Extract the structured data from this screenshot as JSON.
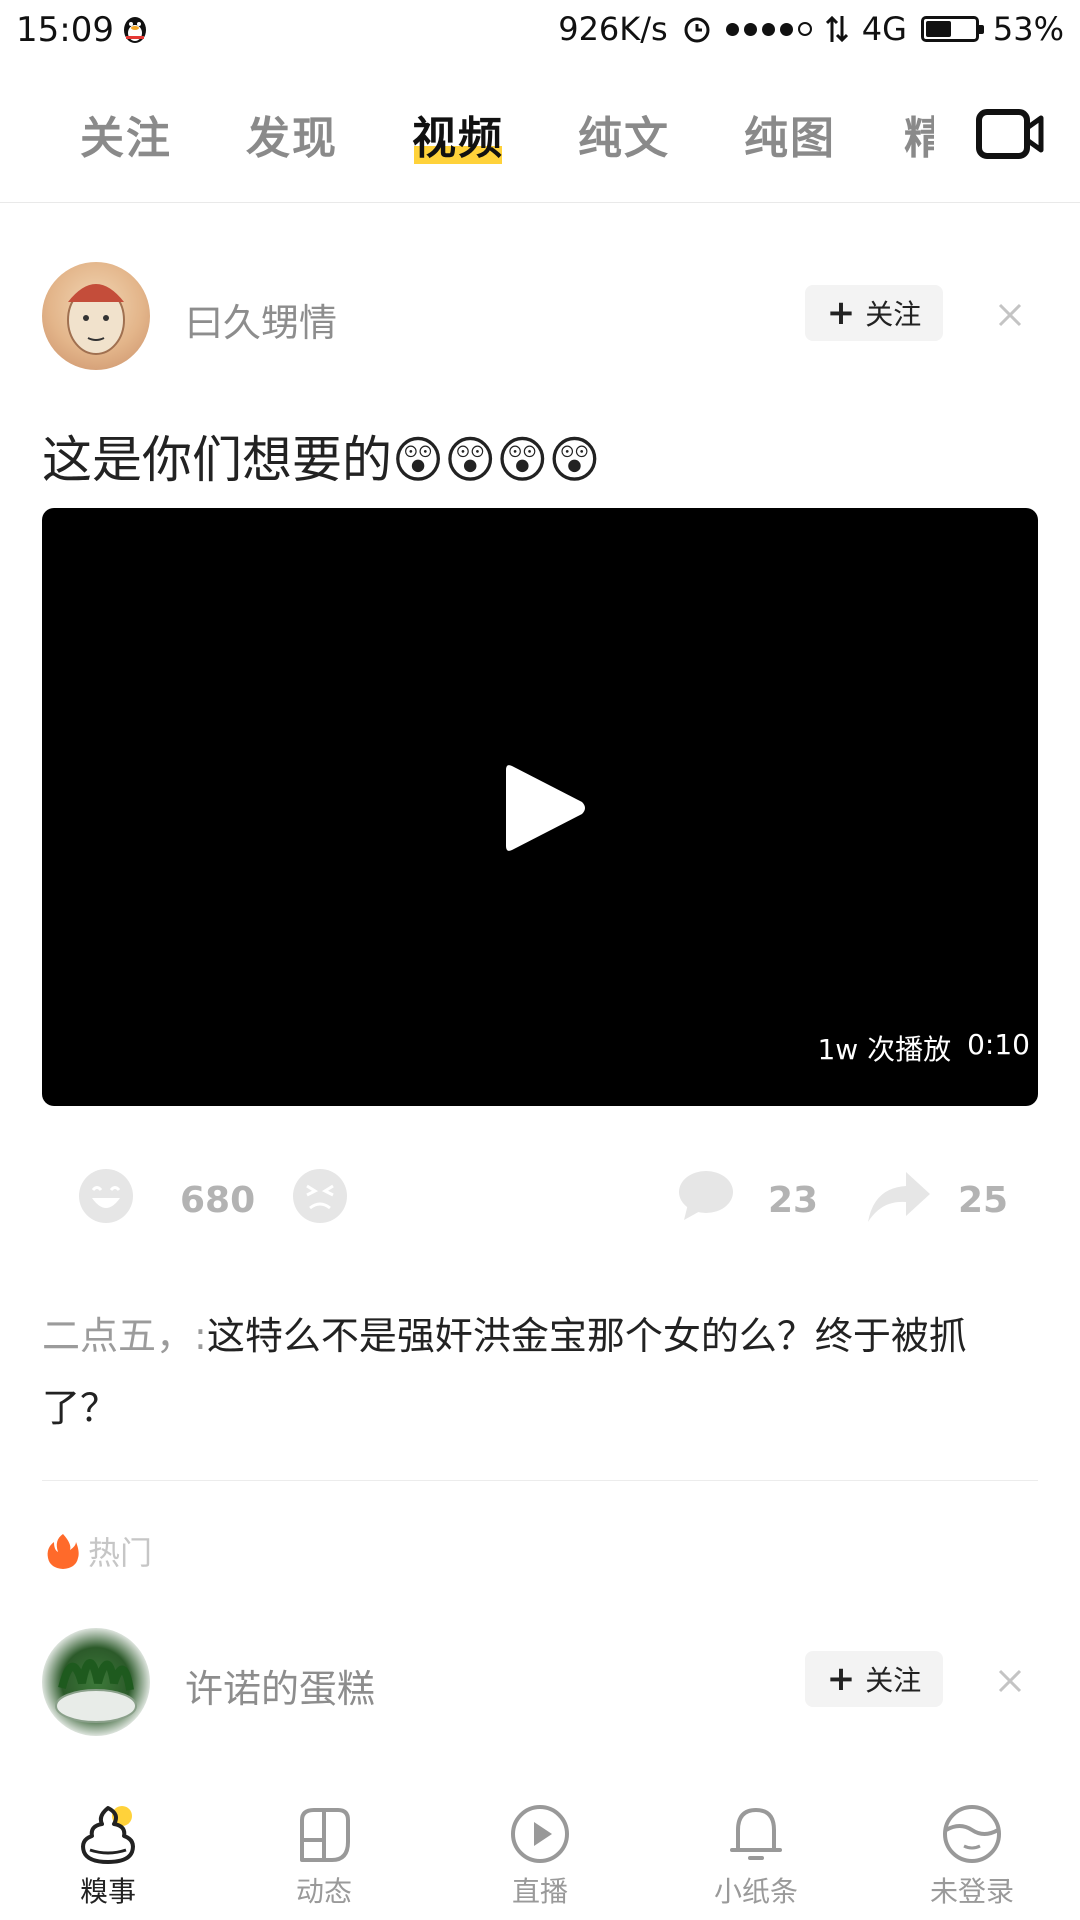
{
  "status_bar": {
    "time": "15:09",
    "speed": "926K/s",
    "network": "4G",
    "battery": "53%",
    "battery_level": 0.53
  },
  "tabs": [
    {
      "label": "关注",
      "active": false
    },
    {
      "label": "发现",
      "active": false
    },
    {
      "label": "视频",
      "active": true
    },
    {
      "label": "纯文",
      "active": false
    },
    {
      "label": "纯图",
      "active": false
    }
  ],
  "tab_cut_label": "精",
  "accent_color": "#ffd23a",
  "post": {
    "username": "曰久甥情",
    "follow_label": "关注",
    "title": "这是你们想要的",
    "title_emojis": "😲😲😲😲",
    "video_views": "1w 次播放",
    "video_duration": "0:10",
    "likes": "680",
    "comments": "23",
    "shares": "25",
    "comment_user": "二点五，:",
    "comment_text": "这特么不是强奸洪金宝那个女的么？终于被抓了？"
  },
  "hot_label": "热门",
  "post2": {
    "username": "许诺的蛋糕",
    "follow_label": "关注"
  },
  "bottom_nav": [
    {
      "label": "糗事",
      "icon": "poop-icon",
      "active": true
    },
    {
      "label": "动态",
      "icon": "cup-icon",
      "active": false
    },
    {
      "label": "直播",
      "icon": "play-circle-icon",
      "active": false
    },
    {
      "label": "小纸条",
      "icon": "bell-icon",
      "active": false
    },
    {
      "label": "未登录",
      "icon": "profile-icon",
      "active": false
    }
  ]
}
